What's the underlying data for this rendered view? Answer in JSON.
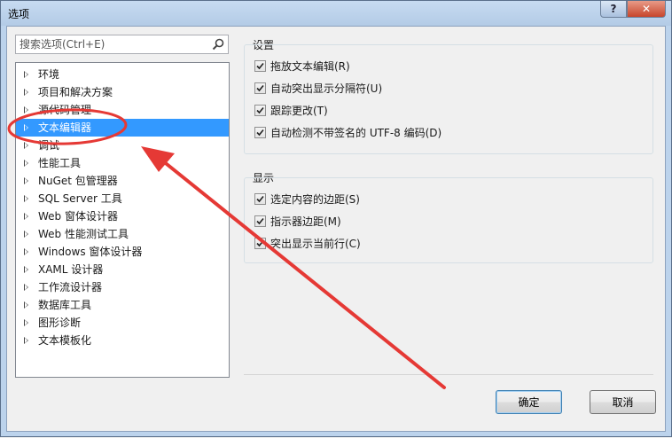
{
  "window": {
    "title": "选项"
  },
  "titlebar": {
    "help": "?",
    "close": "✕"
  },
  "search": {
    "placeholder": "搜索选项(Ctrl+E)"
  },
  "tree": {
    "items": [
      {
        "label": "环境",
        "selected": false
      },
      {
        "label": "项目和解决方案",
        "selected": false
      },
      {
        "label": "源代码管理",
        "selected": false
      },
      {
        "label": "文本编辑器",
        "selected": true
      },
      {
        "label": "调试",
        "selected": false
      },
      {
        "label": "性能工具",
        "selected": false
      },
      {
        "label": "NuGet 包管理器",
        "selected": false
      },
      {
        "label": "SQL Server 工具",
        "selected": false
      },
      {
        "label": "Web 窗体设计器",
        "selected": false
      },
      {
        "label": "Web 性能测试工具",
        "selected": false
      },
      {
        "label": "Windows 窗体设计器",
        "selected": false
      },
      {
        "label": "XAML 设计器",
        "selected": false
      },
      {
        "label": "工作流设计器",
        "selected": false
      },
      {
        "label": "数据库工具",
        "selected": false
      },
      {
        "label": "图形诊断",
        "selected": false
      },
      {
        "label": "文本模板化",
        "selected": false
      }
    ]
  },
  "settings": {
    "title": "设置",
    "options": [
      {
        "label": "拖放文本编辑(R)",
        "checked": true
      },
      {
        "label": "自动突出显示分隔符(U)",
        "checked": true
      },
      {
        "label": "跟踪更改(T)",
        "checked": true
      },
      {
        "label": "自动检测不带签名的 UTF-8 编码(D)",
        "checked": true
      }
    ]
  },
  "display": {
    "title": "显示",
    "options": [
      {
        "label": "选定内容的边距(S)",
        "checked": true
      },
      {
        "label": "指示器边距(M)",
        "checked": true
      },
      {
        "label": "突出显示当前行(C)",
        "checked": true
      }
    ]
  },
  "buttons": {
    "ok": "确定",
    "cancel": "取消"
  },
  "colors": {
    "selection": "#3399ff",
    "annotation": "#e53935"
  }
}
